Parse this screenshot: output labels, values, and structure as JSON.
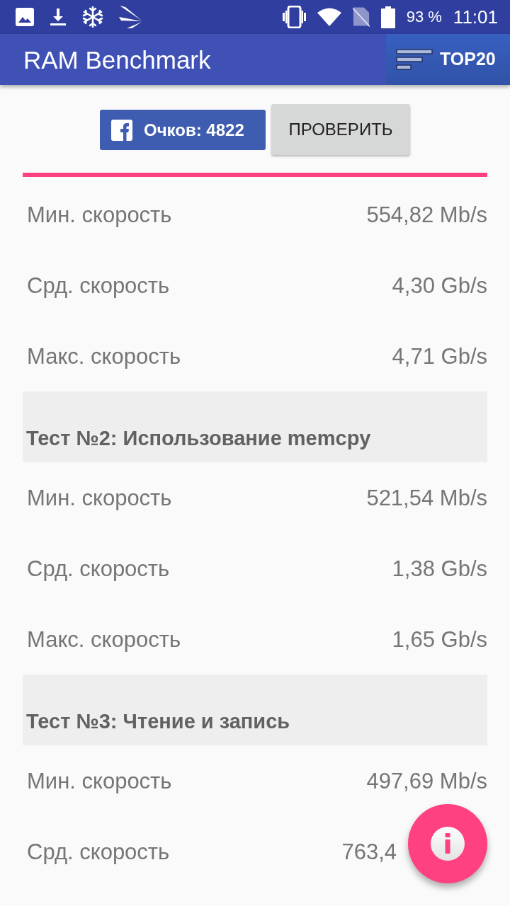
{
  "status_bar": {
    "battery": "93 %",
    "time": "11:01"
  },
  "app_bar": {
    "title": "RAM Benchmark",
    "top_button": "TOP20"
  },
  "actions": {
    "score_button": "Очков: 4822",
    "check_button": "ПРОВЕРИТЬ"
  },
  "sections": [
    {
      "rows": [
        {
          "label": "Мин. скорость",
          "value": "554,82 Mb/s"
        },
        {
          "label": "Срд. скорость",
          "value": "4,30 Gb/s"
        },
        {
          "label": "Макс. скорость",
          "value": "4,71 Gb/s"
        }
      ]
    },
    {
      "title": "Тест №2: Использование memcpy",
      "rows": [
        {
          "label": "Мин. скорость",
          "value": "521,54 Mb/s"
        },
        {
          "label": "Срд. скорость",
          "value": "1,38 Gb/s"
        },
        {
          "label": "Макс. скорость",
          "value": "1,65 Gb/s"
        }
      ]
    },
    {
      "title": "Тест №3: Чтение и запись",
      "rows": [
        {
          "label": "Мин. скорость",
          "value": "497,69 Mb/s"
        },
        {
          "label": "Срд. скорость",
          "value": "763,4"
        }
      ]
    }
  ]
}
